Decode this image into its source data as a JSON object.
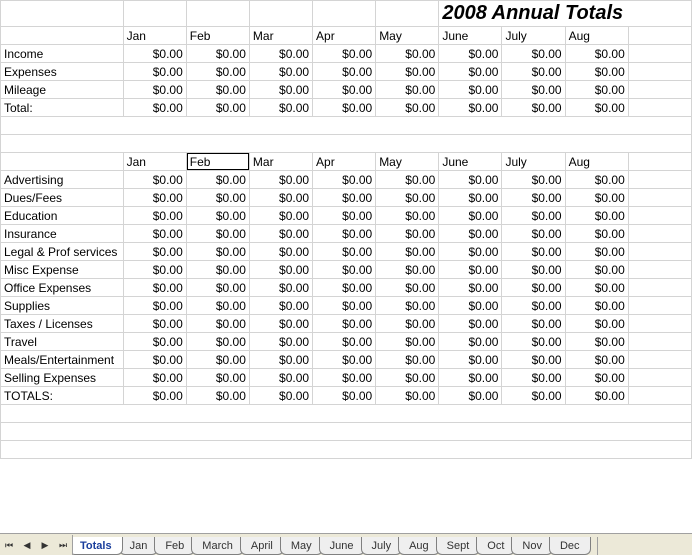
{
  "title": "2008 Annual Totals",
  "months": [
    "Jan",
    "Feb",
    "Mar",
    "Apr",
    "May",
    "June",
    "July",
    "Aug"
  ],
  "section1_rows": [
    {
      "label": "Income",
      "vals": [
        "$0.00",
        "$0.00",
        "$0.00",
        "$0.00",
        "$0.00",
        "$0.00",
        "$0.00",
        "$0.00"
      ]
    },
    {
      "label": "Expenses",
      "vals": [
        "$0.00",
        "$0.00",
        "$0.00",
        "$0.00",
        "$0.00",
        "$0.00",
        "$0.00",
        "$0.00"
      ]
    },
    {
      "label": "Mileage",
      "vals": [
        "$0.00",
        "$0.00",
        "$0.00",
        "$0.00",
        "$0.00",
        "$0.00",
        "$0.00",
        "$0.00"
      ]
    },
    {
      "label": "Total:",
      "vals": [
        "$0.00",
        "$0.00",
        "$0.00",
        "$0.00",
        "$0.00",
        "$0.00",
        "$0.00",
        "$0.00"
      ]
    }
  ],
  "section2_rows": [
    {
      "label": "Advertising",
      "vals": [
        "$0.00",
        "$0.00",
        "$0.00",
        "$0.00",
        "$0.00",
        "$0.00",
        "$0.00",
        "$0.00"
      ]
    },
    {
      "label": "Dues/Fees",
      "vals": [
        "$0.00",
        "$0.00",
        "$0.00",
        "$0.00",
        "$0.00",
        "$0.00",
        "$0.00",
        "$0.00"
      ]
    },
    {
      "label": "Education",
      "vals": [
        "$0.00",
        "$0.00",
        "$0.00",
        "$0.00",
        "$0.00",
        "$0.00",
        "$0.00",
        "$0.00"
      ]
    },
    {
      "label": "Insurance",
      "vals": [
        "$0.00",
        "$0.00",
        "$0.00",
        "$0.00",
        "$0.00",
        "$0.00",
        "$0.00",
        "$0.00"
      ]
    },
    {
      "label": "Legal & Prof services",
      "vals": [
        "$0.00",
        "$0.00",
        "$0.00",
        "$0.00",
        "$0.00",
        "$0.00",
        "$0.00",
        "$0.00"
      ]
    },
    {
      "label": "Misc Expense",
      "vals": [
        "$0.00",
        "$0.00",
        "$0.00",
        "$0.00",
        "$0.00",
        "$0.00",
        "$0.00",
        "$0.00"
      ]
    },
    {
      "label": "Office Expenses",
      "vals": [
        "$0.00",
        "$0.00",
        "$0.00",
        "$0.00",
        "$0.00",
        "$0.00",
        "$0.00",
        "$0.00"
      ]
    },
    {
      "label": "Supplies",
      "vals": [
        "$0.00",
        "$0.00",
        "$0.00",
        "$0.00",
        "$0.00",
        "$0.00",
        "$0.00",
        "$0.00"
      ]
    },
    {
      "label": "Taxes / Licenses",
      "vals": [
        "$0.00",
        "$0.00",
        "$0.00",
        "$0.00",
        "$0.00",
        "$0.00",
        "$0.00",
        "$0.00"
      ]
    },
    {
      "label": "Travel",
      "vals": [
        "$0.00",
        "$0.00",
        "$0.00",
        "$0.00",
        "$0.00",
        "$0.00",
        "$0.00",
        "$0.00"
      ]
    },
    {
      "label": "Meals/Entertainment",
      "vals": [
        "$0.00",
        "$0.00",
        "$0.00",
        "$0.00",
        "$0.00",
        "$0.00",
        "$0.00",
        "$0.00"
      ]
    },
    {
      "label": "Selling Expenses",
      "vals": [
        "$0.00",
        "$0.00",
        "$0.00",
        "$0.00",
        "$0.00",
        "$0.00",
        "$0.00",
        "$0.00"
      ]
    },
    {
      "label": "TOTALS:",
      "vals": [
        "$0.00",
        "$0.00",
        "$0.00",
        "$0.00",
        "$0.00",
        "$0.00",
        "$0.00",
        "$0.00"
      ]
    }
  ],
  "selected_cell": {
    "section": 2,
    "col": 1
  },
  "tabs": {
    "active": "Totals",
    "list": [
      "Totals",
      "Jan",
      "Feb",
      "March",
      "April",
      "May",
      "June",
      "July",
      "Aug",
      "Sept",
      "Oct",
      "Nov",
      "Dec"
    ]
  },
  "nav_glyphs": {
    "first": "⏮",
    "prev": "◀",
    "next": "▶",
    "last": "⏭"
  }
}
